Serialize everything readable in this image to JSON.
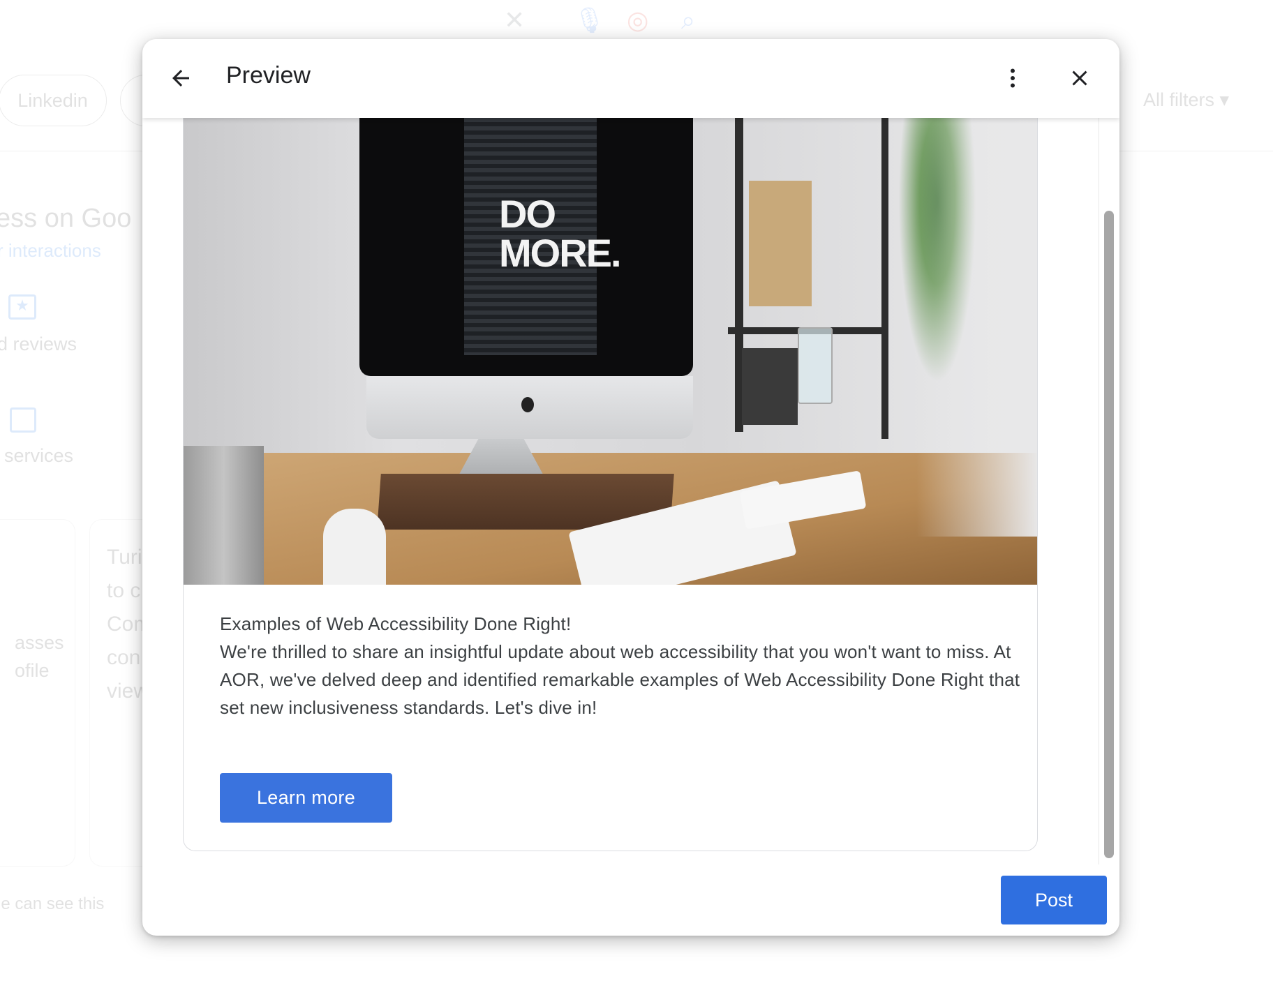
{
  "background": {
    "search_icons": [
      "clear-icon",
      "mic-icon",
      "lens-icon",
      "search-icon"
    ],
    "chip_linkedin": "Linkedin",
    "all_filters": "All filters",
    "heading_fragment": "ess on Goo",
    "link_fragment": "r interactions",
    "reviews_fragment": "d reviews",
    "services_fragment": "services",
    "card1_lines": [
      "asses",
      "ofile"
    ],
    "card2_lines": [
      "Turi",
      "to c",
      "Com",
      "con",
      "view"
    ],
    "footer_fragment": "le can see this"
  },
  "dialog": {
    "title": "Preview",
    "back_icon": "arrow-back-icon",
    "more_icon": "more-vert-icon",
    "close_icon": "close-icon",
    "image_text": "DO MORE.",
    "post_title": "Examples of Web Accessibility Done Right!",
    "post_body": "We're thrilled to share an insightful update about web accessibility that you won't want to miss. At AOR, we've delved deep and identified remarkable examples of Web Accessibility Done Right that set new inclusiveness standards. Let's dive in!",
    "cta_label": "Learn more",
    "post_button": "Post",
    "colors": {
      "primary": "#3a73de"
    }
  }
}
